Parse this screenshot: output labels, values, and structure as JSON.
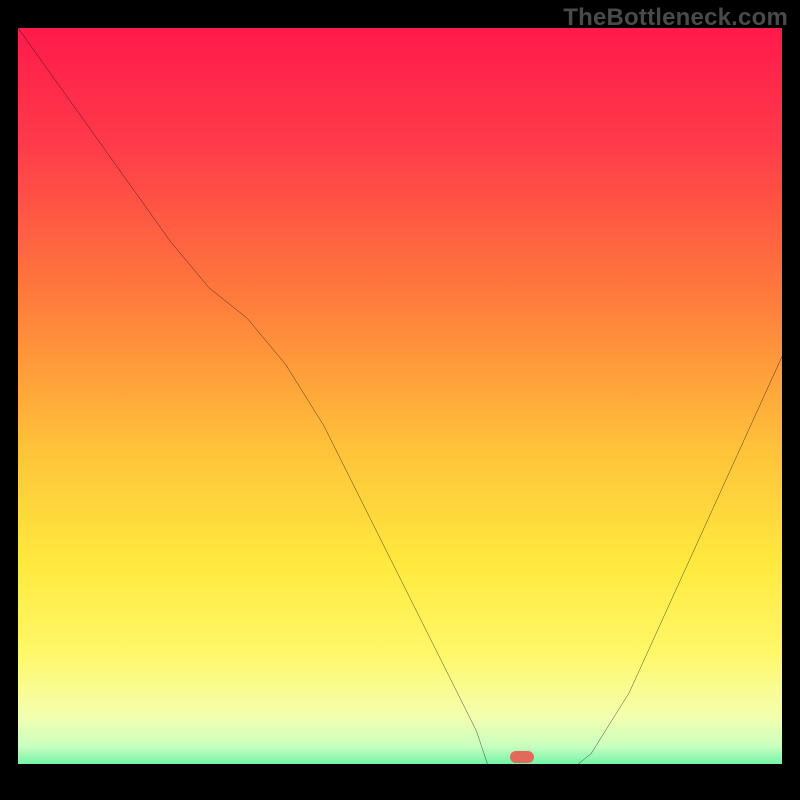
{
  "watermark": "TheBottleneck.com",
  "chart_data": {
    "type": "line",
    "title": "",
    "xlabel": "",
    "ylabel": "",
    "xlim": [
      0,
      100
    ],
    "ylim": [
      0,
      100
    ],
    "grid": false,
    "legend": false,
    "x": [
      0,
      5,
      10,
      15,
      20,
      25,
      30,
      35,
      40,
      45,
      50,
      55,
      60,
      62,
      65,
      67,
      70,
      75,
      80,
      85,
      90,
      95,
      100
    ],
    "values": [
      100,
      93,
      86,
      79,
      72,
      66,
      62,
      56,
      48,
      38,
      28,
      18,
      8,
      2,
      1,
      1,
      1,
      5,
      13,
      24,
      35,
      46,
      57
    ],
    "annotations": [
      {
        "type": "marker",
        "x": 66,
        "y": 1,
        "shape": "pill",
        "color": "#e26a5a"
      }
    ],
    "background_gradient": [
      {
        "stop": 0.0,
        "color": "#ff1a4b"
      },
      {
        "stop": 0.15,
        "color": "#ff3a4a"
      },
      {
        "stop": 0.35,
        "color": "#ff7a3c"
      },
      {
        "stop": 0.55,
        "color": "#ffc23a"
      },
      {
        "stop": 0.7,
        "color": "#ffe93e"
      },
      {
        "stop": 0.82,
        "color": "#fff86a"
      },
      {
        "stop": 0.9,
        "color": "#f4ffae"
      },
      {
        "stop": 0.94,
        "color": "#c9ffc0"
      },
      {
        "stop": 0.97,
        "color": "#5ef0a0"
      },
      {
        "stop": 1.0,
        "color": "#00e07a"
      }
    ]
  }
}
